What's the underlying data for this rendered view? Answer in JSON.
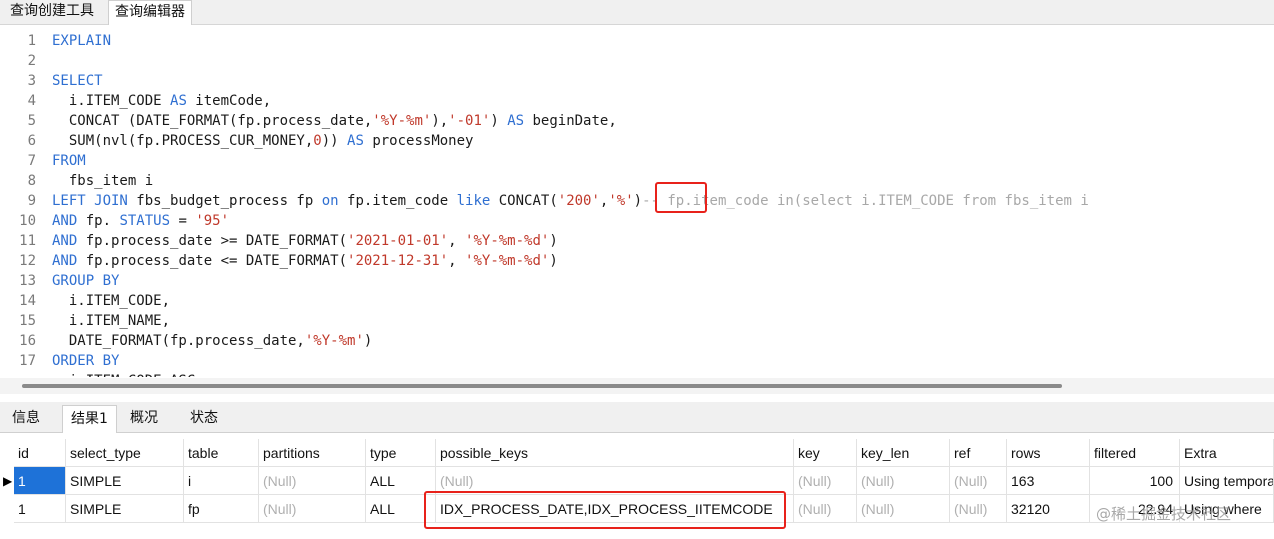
{
  "top_tabs": [
    "查询创建工具",
    "查询编辑器"
  ],
  "editor": {
    "line_numbers": [
      "1",
      "2",
      "3",
      "4",
      "5",
      "6",
      "7",
      "8",
      "9",
      "10",
      "11",
      "12",
      "13",
      "14",
      "15",
      "16",
      "17"
    ],
    "lines": [
      [
        {
          "t": "EXPLAIN",
          "c": "kw"
        }
      ],
      [],
      [
        {
          "t": "SELECT",
          "c": "kw"
        }
      ],
      [
        {
          "t": "  i.ITEM_CODE "
        },
        {
          "t": "AS",
          "c": "kw"
        },
        {
          "t": " itemCode,"
        }
      ],
      [
        {
          "t": "  CONCAT (DATE_FORMAT(fp.process_date,"
        },
        {
          "t": "'%Y-%m'",
          "c": "str"
        },
        {
          "t": "),"
        },
        {
          "t": "'-01'",
          "c": "str"
        },
        {
          "t": ") "
        },
        {
          "t": "AS",
          "c": "kw"
        },
        {
          "t": " beginDate,"
        }
      ],
      [
        {
          "t": "  SUM(nvl(fp.PROCESS_CUR_MONEY,"
        },
        {
          "t": "0",
          "c": "num"
        },
        {
          "t": ")) "
        },
        {
          "t": "AS",
          "c": "kw"
        },
        {
          "t": " processMoney"
        }
      ],
      [
        {
          "t": "FROM",
          "c": "kw"
        }
      ],
      [
        {
          "t": "  fbs_item i"
        }
      ],
      [
        {
          "t": "LEFT JOIN",
          "c": "kw"
        },
        {
          "t": " fbs_budget_process fp "
        },
        {
          "t": "on",
          "c": "kw"
        },
        {
          "t": " fp.item_code "
        },
        {
          "t": "like",
          "c": "kw"
        },
        {
          "t": " CONCAT("
        },
        {
          "t": "'200'",
          "c": "str"
        },
        {
          "t": ","
        },
        {
          "t": "'%'",
          "c": "str"
        },
        {
          "t": ")"
        },
        {
          "t": "-- fp.item_code in(select i.ITEM_CODE from fbs_item i",
          "c": "cmt"
        }
      ],
      [
        {
          "t": "AND",
          "c": "kw"
        },
        {
          "t": " fp. "
        },
        {
          "t": "STATUS",
          "c": "kw"
        },
        {
          "t": " = "
        },
        {
          "t": "'95'",
          "c": "str"
        }
      ],
      [
        {
          "t": "AND",
          "c": "kw"
        },
        {
          "t": " fp.process_date >= DATE_FORMAT("
        },
        {
          "t": "'2021-01-01'",
          "c": "str"
        },
        {
          "t": ", "
        },
        {
          "t": "'%Y-%m-%d'",
          "c": "str"
        },
        {
          "t": ")"
        }
      ],
      [
        {
          "t": "AND",
          "c": "kw"
        },
        {
          "t": " fp.process_date <= DATE_FORMAT("
        },
        {
          "t": "'2021-12-31'",
          "c": "str"
        },
        {
          "t": ", "
        },
        {
          "t": "'%Y-%m-%d'",
          "c": "str"
        },
        {
          "t": ")"
        }
      ],
      [
        {
          "t": "GROUP BY",
          "c": "kw"
        }
      ],
      [
        {
          "t": "  i.ITEM_CODE,"
        }
      ],
      [
        {
          "t": "  i.ITEM_NAME,"
        }
      ],
      [
        {
          "t": "  DATE_FORMAT(fp.process_date,"
        },
        {
          "t": "'%Y-%m'",
          "c": "str"
        },
        {
          "t": ")"
        }
      ],
      [
        {
          "t": "ORDER BY",
          "c": "kw"
        }
      ]
    ],
    "partial_last_line": "  i.ITEM_CODE ASC"
  },
  "result_tabs": [
    "信息",
    "结果1",
    "概况",
    "状态"
  ],
  "result_grid": {
    "columns": [
      "id",
      "select_type",
      "table",
      "partitions",
      "type",
      "possible_keys",
      "key",
      "key_len",
      "ref",
      "rows",
      "filtered",
      "Extra"
    ],
    "rows": [
      [
        "1",
        "SIMPLE",
        "i",
        "(Null)",
        "ALL",
        "(Null)",
        "(Null)",
        "(Null)",
        "(Null)",
        "163",
        "100",
        "Using temporary; Using filesort"
      ],
      [
        "1",
        "SIMPLE",
        "fp",
        "(Null)",
        "ALL",
        "IDX_PROCESS_DATE,IDX_PROCESS_IITEMCODE",
        "(Null)",
        "(Null)",
        "(Null)",
        "32120",
        "22.94",
        "Using where"
      ]
    ]
  },
  "watermark": "@稀土掘金技术社区",
  "colors": {
    "keyword": "#2f6fd1",
    "string": "#c0392b",
    "comment": "#a8a8a8",
    "highlight": "#e8221b",
    "selection": "#1e72d8"
  }
}
